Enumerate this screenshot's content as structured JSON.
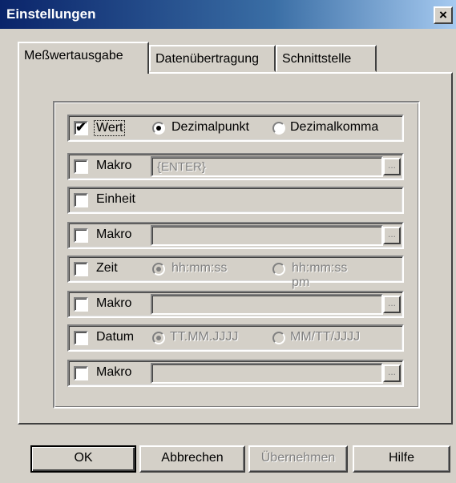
{
  "window": {
    "title": "Einstellungen",
    "close_glyph": "×"
  },
  "tabs": [
    {
      "label": "Meßwertausgabe",
      "active": true
    },
    {
      "label": "Datenübertragung",
      "active": false
    },
    {
      "label": "Schnittstelle",
      "active": false
    }
  ],
  "rows": {
    "wert": {
      "label": "Wert",
      "checked": true,
      "radio1": "Dezimalpunkt",
      "radio2": "Dezimalkomma",
      "selected": "Dezimalpunkt"
    },
    "makro1": {
      "label": "Makro",
      "checked": false,
      "value": "{ENTER}"
    },
    "einheit": {
      "label": "Einheit",
      "checked": false
    },
    "makro2": {
      "label": "Makro",
      "checked": false,
      "value": ""
    },
    "zeit": {
      "label": "Zeit",
      "checked": false,
      "radio1": "hh:mm:ss",
      "radio2": "hh:mm:ss pm",
      "selected": "hh:mm:ss"
    },
    "makro3": {
      "label": "Makro",
      "checked": false,
      "value": ""
    },
    "datum": {
      "label": "Datum",
      "checked": false,
      "radio1": "TT.MM.JJJJ",
      "radio2": "MM/TT/JJJJ",
      "selected": "TT.MM.JJJJ"
    },
    "makro4": {
      "label": "Makro",
      "checked": false,
      "value": ""
    }
  },
  "ellipsis_glyph": "...",
  "check_glyph": "✔",
  "buttons": {
    "ok": "OK",
    "cancel": "Abbrechen",
    "apply": "Übernehmen",
    "help": "Hilfe"
  },
  "colors": {
    "face": "#d4d0c8",
    "title_bar": "#0a246a",
    "disabled_text": "#808080"
  }
}
